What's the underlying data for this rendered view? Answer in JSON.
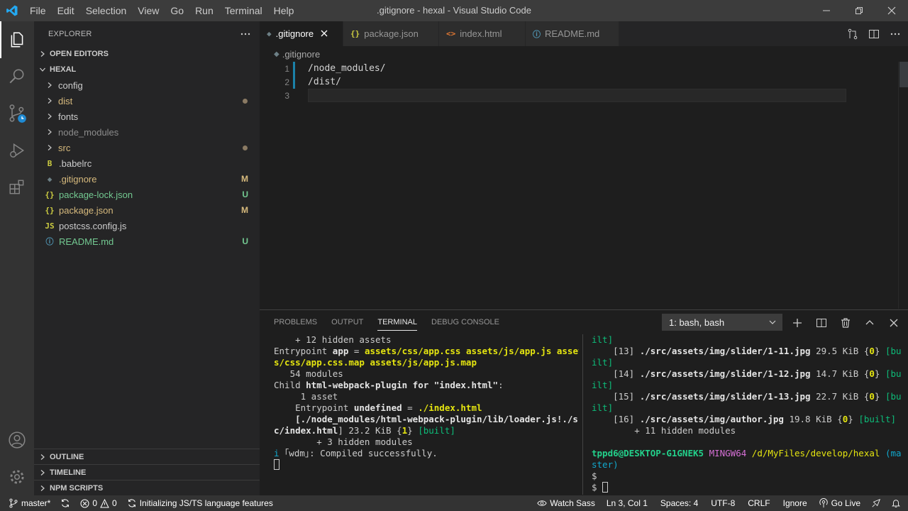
{
  "window": {
    "title": ".gitignore - hexal - Visual Studio Code",
    "menu": [
      "File",
      "Edit",
      "Selection",
      "View",
      "Go",
      "Run",
      "Terminal",
      "Help"
    ]
  },
  "sidebar": {
    "title": "EXPLORER",
    "open_editors": "OPEN EDITORS",
    "project": "HEXAL",
    "tree": [
      {
        "label": "config",
        "type": "folder",
        "color": "#cccccc",
        "status": ""
      },
      {
        "label": "dist",
        "type": "folder",
        "color": "#d7ba7d",
        "status": "dot"
      },
      {
        "label": "fonts",
        "type": "folder",
        "color": "#cccccc",
        "status": ""
      },
      {
        "label": "node_modules",
        "type": "folder",
        "color": "#8c8c8c",
        "status": ""
      },
      {
        "label": "src",
        "type": "folder",
        "color": "#d7ba7d",
        "status": "dot"
      },
      {
        "label": ".babelrc",
        "type": "file",
        "icon": "B",
        "icon_color": "#cbcb41",
        "color": "#cccccc",
        "status": ""
      },
      {
        "label": ".gitignore",
        "type": "file",
        "icon": "◆",
        "icon_color": "#6d8086",
        "color": "#d7ba7d",
        "status": "M"
      },
      {
        "label": "package-lock.json",
        "type": "file",
        "icon": "{}",
        "icon_color": "#cbcb41",
        "color": "#73c991",
        "status": "U"
      },
      {
        "label": "package.json",
        "type": "file",
        "icon": "{}",
        "icon_color": "#cbcb41",
        "color": "#d7ba7d",
        "status": "M"
      },
      {
        "label": "postcss.config.js",
        "type": "file",
        "icon": "JS",
        "icon_color": "#cbcb41",
        "color": "#cccccc",
        "status": ""
      },
      {
        "label": "README.md",
        "type": "file",
        "icon": "ⓘ",
        "icon_color": "#519aba",
        "color": "#73c991",
        "status": "U"
      }
    ],
    "outline": "OUTLINE",
    "timeline": "TIMELINE",
    "npm_scripts": "NPM SCRIPTS"
  },
  "tabs": [
    {
      "label": ".gitignore",
      "icon": "◆",
      "icon_color": "#6d8086",
      "active": true
    },
    {
      "label": "package.json",
      "icon": "{}",
      "icon_color": "#cbcb41",
      "active": false
    },
    {
      "label": "index.html",
      "icon": "<>",
      "icon_color": "#e37933",
      "active": false
    },
    {
      "label": "README.md",
      "icon": "ⓘ",
      "icon_color": "#519aba",
      "active": false
    }
  ],
  "breadcrumb": ".gitignore",
  "editor": {
    "lines": [
      {
        "num": "1",
        "text": "/node_modules/"
      },
      {
        "num": "2",
        "text": "/dist/"
      },
      {
        "num": "3",
        "text": ""
      }
    ]
  },
  "panel": {
    "tabs": [
      "PROBLEMS",
      "OUTPUT",
      "TERMINAL",
      "DEBUG CONSOLE"
    ],
    "active_tab": "TERMINAL",
    "terminal_select": "1: bash, bash"
  },
  "terminal_left": [
    [
      {
        "t": "    + 12 hidden assets"
      }
    ],
    [
      {
        "t": "Entrypoint "
      },
      {
        "t": "app",
        "c": "b"
      },
      {
        "t": " = "
      },
      {
        "t": "assets/css/app.css assets/js/app.js asset",
        "c": "y"
      }
    ],
    [
      {
        "t": "s/css/app.css.map assets/js/app.js.map",
        "c": "y"
      }
    ],
    [
      {
        "t": "   54 modules"
      }
    ],
    [
      {
        "t": "Child "
      },
      {
        "t": "html-webpack-plugin for \"index.html\"",
        "c": "b"
      },
      {
        "t": ":"
      }
    ],
    [
      {
        "t": "     1 asset"
      }
    ],
    [
      {
        "t": "    Entrypoint "
      },
      {
        "t": "undefined",
        "c": "b"
      },
      {
        "t": " = "
      },
      {
        "t": "./index.html",
        "c": "y"
      }
    ],
    [
      {
        "t": "    [./node_modules/html-webpack-plugin/lib/loader.js!./sr",
        "c": "b"
      }
    ],
    [
      {
        "t": "c/index.html",
        "c": "b"
      },
      {
        "t": "] 23.2 KiB {"
      },
      {
        "t": "1",
        "c": "y"
      },
      {
        "t": "} "
      },
      {
        "t": "[built]",
        "c": "g"
      }
    ],
    [
      {
        "t": "        + 3 hidden modules"
      }
    ],
    [
      {
        "t": "i",
        "c": "c"
      },
      {
        "t": " ｢wdm｣: Compiled successfully."
      }
    ],
    [
      {
        "t": "",
        "cursor": true
      }
    ]
  ],
  "terminal_right": [
    [
      {
        "t": "ilt]",
        "c": "g"
      }
    ],
    [
      {
        "t": "    [13] "
      },
      {
        "t": "./src/assets/img/slider/1-11.jpg",
        "c": "b"
      },
      {
        "t": " 29.5 KiB {"
      },
      {
        "t": "0",
        "c": "y"
      },
      {
        "t": "} "
      },
      {
        "t": "[bu",
        "c": "g"
      }
    ],
    [
      {
        "t": "ilt]",
        "c": "g"
      }
    ],
    [
      {
        "t": "    [14] "
      },
      {
        "t": "./src/assets/img/slider/1-12.jpg",
        "c": "b"
      },
      {
        "t": " 14.7 KiB {"
      },
      {
        "t": "0",
        "c": "y"
      },
      {
        "t": "} "
      },
      {
        "t": "[bu",
        "c": "g"
      }
    ],
    [
      {
        "t": "ilt]",
        "c": "g"
      }
    ],
    [
      {
        "t": "    [15] "
      },
      {
        "t": "./src/assets/img/slider/1-13.jpg",
        "c": "b"
      },
      {
        "t": " 22.7 KiB {"
      },
      {
        "t": "0",
        "c": "y"
      },
      {
        "t": "} "
      },
      {
        "t": "[bu",
        "c": "g"
      }
    ],
    [
      {
        "t": "ilt]",
        "c": "g"
      }
    ],
    [
      {
        "t": "    [16] "
      },
      {
        "t": "./src/assets/img/author.jpg",
        "c": "b"
      },
      {
        "t": " 19.8 KiB {"
      },
      {
        "t": "0",
        "c": "y"
      },
      {
        "t": "} "
      },
      {
        "t": "[built]",
        "c": "g"
      }
    ],
    [
      {
        "t": "        + 11 hidden modules"
      }
    ],
    [
      {
        "t": ""
      }
    ],
    [
      {
        "t": "tppd6@DESKTOP-G1GNEK5",
        "c": "gb"
      },
      {
        "t": " "
      },
      {
        "t": "MINGW64",
        "c": "m"
      },
      {
        "t": " "
      },
      {
        "t": "/d/MyFiles/develop/hexal",
        "c": "yl"
      },
      {
        "t": " (ma",
        "c": "c"
      }
    ],
    [
      {
        "t": "ster)",
        "c": "c"
      }
    ],
    [
      {
        "t": "$"
      }
    ],
    [
      {
        "t": "$ ",
        "cursor": true
      }
    ]
  ],
  "statusbar": {
    "branch": "master*",
    "errors": "0",
    "warnings": "0",
    "task": "Initializing JS/TS language features",
    "watch_sass": "Watch Sass",
    "position": "Ln 3, Col 1",
    "spaces": "Spaces: 4",
    "encoding": "UTF-8",
    "eol": "CRLF",
    "language": "Ignore",
    "go_live": "Go Live"
  },
  "colors": {
    "accent": "#007acc",
    "titlebar": "#3c3c3c",
    "statusbar": "#333333",
    "modified": "#d7ba7d",
    "untracked": "#73c991"
  }
}
